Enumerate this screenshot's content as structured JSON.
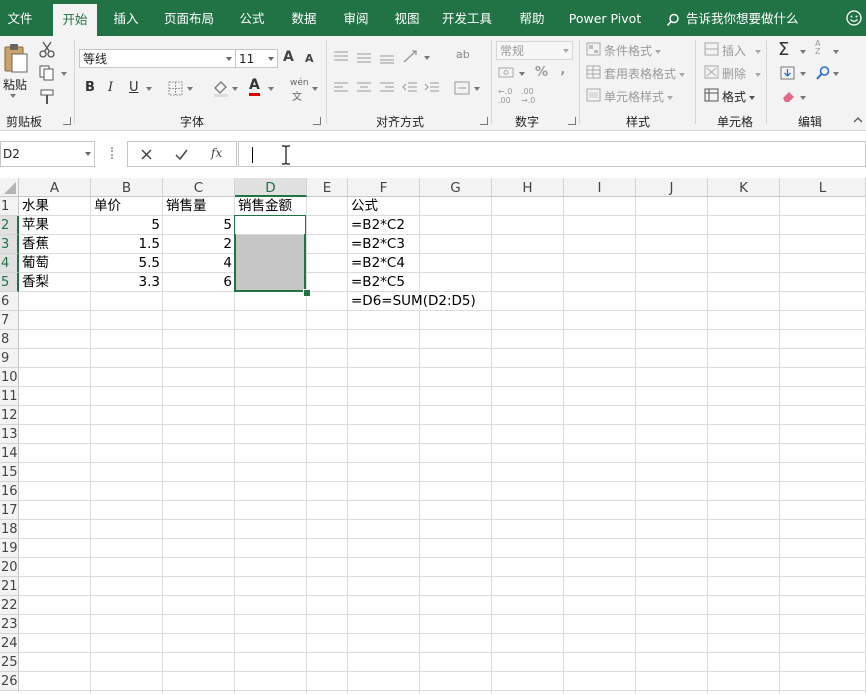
{
  "tabs": [
    "文件",
    "开始",
    "插入",
    "页面布局",
    "公式",
    "数据",
    "审阅",
    "视图",
    "开发工具",
    "帮助",
    "Power Pivot"
  ],
  "tell_me": "告诉我你想要做什么",
  "ribbon": {
    "clipboard": {
      "paste": "粘贴",
      "label": "剪贴板"
    },
    "font": {
      "name": "等线",
      "size": "11",
      "grow": "A",
      "shrink": "A",
      "bold": "B",
      "italic": "I",
      "underline": "U",
      "font_color": "A",
      "wen": "wén",
      "wen2": "文",
      "label": "字体"
    },
    "alignment": {
      "label": "对齐方式"
    },
    "number": {
      "format": "常规",
      "percent": "%",
      "comma": "‚",
      "inc": "←.0 .00",
      "dec": ".00 →.0",
      "label": "数字"
    },
    "styles": {
      "conditional": "条件格式",
      "table": "套用表格格式",
      "cell_styles": "单元格样式",
      "label": "样式"
    },
    "cells": {
      "insert": "插入",
      "delete": "删除",
      "format": "格式",
      "label": "单元格"
    },
    "editing": {
      "sum": "Σ",
      "sort": "A Z",
      "label": "编辑"
    }
  },
  "formula_bar": {
    "name_box": "D2",
    "fx": "fx",
    "value": ""
  },
  "columns": [
    "A",
    "B",
    "C",
    "D",
    "E",
    "F",
    "G",
    "H",
    "I",
    "J",
    "K",
    "L"
  ],
  "rows": [
    "1",
    "2",
    "3",
    "4",
    "5",
    "6",
    "7",
    "8",
    "9",
    "10",
    "11",
    "12",
    "13",
    "14",
    "15",
    "16",
    "17",
    "18",
    "19",
    "20",
    "21",
    "22",
    "23",
    "24",
    "25",
    "26"
  ],
  "selected_cell": "D2",
  "cells": [
    {
      "ref": "A1",
      "v": "水果"
    },
    {
      "ref": "B1",
      "v": "单价"
    },
    {
      "ref": "C1",
      "v": "销售量"
    },
    {
      "ref": "D1",
      "v": "销售金额"
    },
    {
      "ref": "F1",
      "v": "公式"
    },
    {
      "ref": "A2",
      "v": "苹果"
    },
    {
      "ref": "B2",
      "v": "5",
      "num": true
    },
    {
      "ref": "C2",
      "v": "5",
      "num": true
    },
    {
      "ref": "F2",
      "v": "=B2*C2"
    },
    {
      "ref": "A3",
      "v": "香蕉"
    },
    {
      "ref": "B3",
      "v": "1.5",
      "num": true
    },
    {
      "ref": "C3",
      "v": "2",
      "num": true
    },
    {
      "ref": "F3",
      "v": "=B2*C3"
    },
    {
      "ref": "A4",
      "v": "葡萄"
    },
    {
      "ref": "B4",
      "v": "5.5",
      "num": true
    },
    {
      "ref": "C4",
      "v": "4",
      "num": true
    },
    {
      "ref": "F4",
      "v": "=B2*C4"
    },
    {
      "ref": "A5",
      "v": "香梨"
    },
    {
      "ref": "B5",
      "v": "3.3",
      "num": true
    },
    {
      "ref": "C5",
      "v": "6",
      "num": true
    },
    {
      "ref": "F5",
      "v": "=B2*C5"
    },
    {
      "ref": "F6",
      "v": "=D6=SUM(D2:D5)"
    }
  ]
}
